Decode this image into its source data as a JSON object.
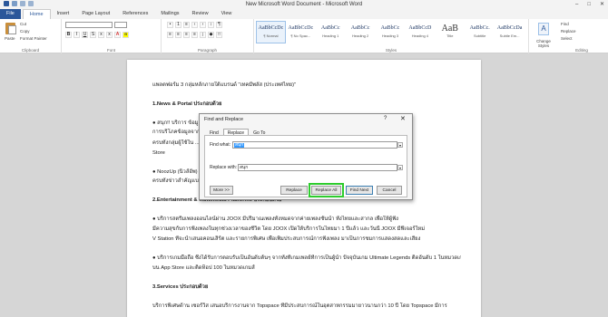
{
  "window": {
    "title": "New Microsoft Word Document - Microsoft Word",
    "controls": [
      "–",
      "□",
      "✕"
    ]
  },
  "tabs": [
    {
      "label": "File",
      "key": "file"
    },
    {
      "label": "Home",
      "key": "active"
    },
    {
      "label": "Insert",
      "key": ""
    },
    {
      "label": "Page Layout",
      "key": ""
    },
    {
      "label": "References",
      "key": ""
    },
    {
      "label": "Mailings",
      "key": ""
    },
    {
      "label": "Review",
      "key": ""
    },
    {
      "label": "View",
      "key": ""
    }
  ],
  "ribbon": {
    "clipboard": {
      "paste": "Paste",
      "cut": "Cut",
      "copy": "Copy",
      "painter": "Format Painter",
      "label": "Clipboard"
    },
    "font": {
      "label": "Font"
    },
    "paragraph": {
      "label": "Paragraph"
    },
    "styles": {
      "label": "Styles",
      "tiles": [
        {
          "sample": "AaBbCcDc",
          "name": "¶ Normal"
        },
        {
          "sample": "AaBbCcDc",
          "name": "¶ No Spac..."
        },
        {
          "sample": "AaBbCc",
          "name": "Heading 1"
        },
        {
          "sample": "AaBbCc",
          "name": "Heading 2"
        },
        {
          "sample": "AaBbCc",
          "name": "Heading 3"
        },
        {
          "sample": "AaBbCcD",
          "name": "Heading 4"
        },
        {
          "sample": "AaB",
          "name": "Title"
        },
        {
          "sample": "AaBbCc.",
          "name": "Subtitle"
        },
        {
          "sample": "AaBbCcDa",
          "name": "Subtle Em..."
        }
      ],
      "change": "Change Styles"
    },
    "editing": {
      "label": "Editing",
      "find": "Find",
      "replace": "Replace",
      "select": "Select"
    }
  },
  "document": {
    "lines": [
      {
        "text": "แพลตฟอร์ม 3 กลุ่มหลักภายใต้แบรนด์ \"เทคมีพลัส (ประเทศไทย)\"",
        "cls": ""
      },
      {
        "text": "1.News & Portal ประกอบด้วย",
        "cls": "h"
      },
      {
        "text": "● สนุก!! บริการ ข้อมูลข่าวสาร ... ที่ครอบคลุมหลายกลุ่มเนื้อหา ... แหล่งรวมข่าวสารครบครัน",
        "cls": ""
      },
      {
        "text": "การบริโภคข้อมูลจากอิน ... ได้จากหลากหลายช่องทาง ... ที่ใช้งานอย่างต่อเนื่อง",
        "cls": ""
      },
      {
        "text": "ครบทั้งกลุ่มผู้ใช้ใน ... ที่สามารถดาวน์โหลดผ่าน App Store และ Play",
        "cls": ""
      },
      {
        "text": "Store",
        "cls": ""
      },
      {
        "text": "● NoozUp (นิวส์อัพ) ... สรุปประเด็นข่าวที่ทุกคนไม่ควรพลาด (Missing Out)",
        "cls": ""
      },
      {
        "text": "ครบทั้งข่าวสำคัญแบบ ... ที่มีรูปแบบให้เลือกอ่านอย่างหลากหลาย",
        "cls": ""
      },
      {
        "text": "2.Entertainment & Multimedia Platforms ประกอบด้วย",
        "cls": "h"
      },
      {
        "text": "● บริการสตรีมเพลงออนไลน์ผ่าน JOOX มีปริมาณเพลงทั้งหมดจากค่ายเพลงชั้นนำ ทั้งไทยและสากล เพื่อให้ผู้ฟัง",
        "cls": ""
      },
      {
        "text": "มีความสุขกับการฟังเพลงในทุกช่วงเวลาของชีวิต โดย JOOX เปิดให้บริการในไทยมา 1 ปีแล้ว และวันนี้ JOOX มีฟีเจอร์ใหม่",
        "cls": ""
      },
      {
        "text": "V Station ที่จะนำเสนอคอนเสิร์ต และรายการพิเศษ เพื่อเพิ่มประสบการณ์การฟังเพลง มาเป็นการชมการแสดงสดและเสียง",
        "cls": ""
      },
      {
        "text": "● บริการเกมมือถือ ซึ่งได้รับการตอบรับเป็นอันดับต้นๆ จากทั้งที่เกมเพลย์ที่การเป็นผู้นำ ปัจจุบันเกม Ultimate Legends ติดอันดับ 1 ในหมวดเกม",
        "cls": ""
      },
      {
        "text": "บน App Store และติดท็อป 100 ในหมวดเกมส์",
        "cls": ""
      },
      {
        "text": "3.Services ประกอบด้วย",
        "cls": "h"
      },
      {
        "text": "บริการพิเศษด้าน เซอร์วิส เสนอบริการงานจาก Topspace ที่มีประสบการณ์ในอุตสาหกรรมมายาวนานกว่า 10 ปี โดย Topspace มีการ",
        "cls": ""
      }
    ]
  },
  "dialog": {
    "title": "Find and Replace",
    "help": "?",
    "close": "✕",
    "tabs": [
      "Find",
      "Replace",
      "Go To"
    ],
    "find_label": "Find what:",
    "find_value": "สนุก",
    "replace_label": "Replace with:",
    "replace_value": "สนุก",
    "buttons": {
      "more": "More >>",
      "replace": "Replace",
      "replace_all": "Replace All",
      "find_next": "Find Next",
      "cancel": "Cancel"
    }
  }
}
